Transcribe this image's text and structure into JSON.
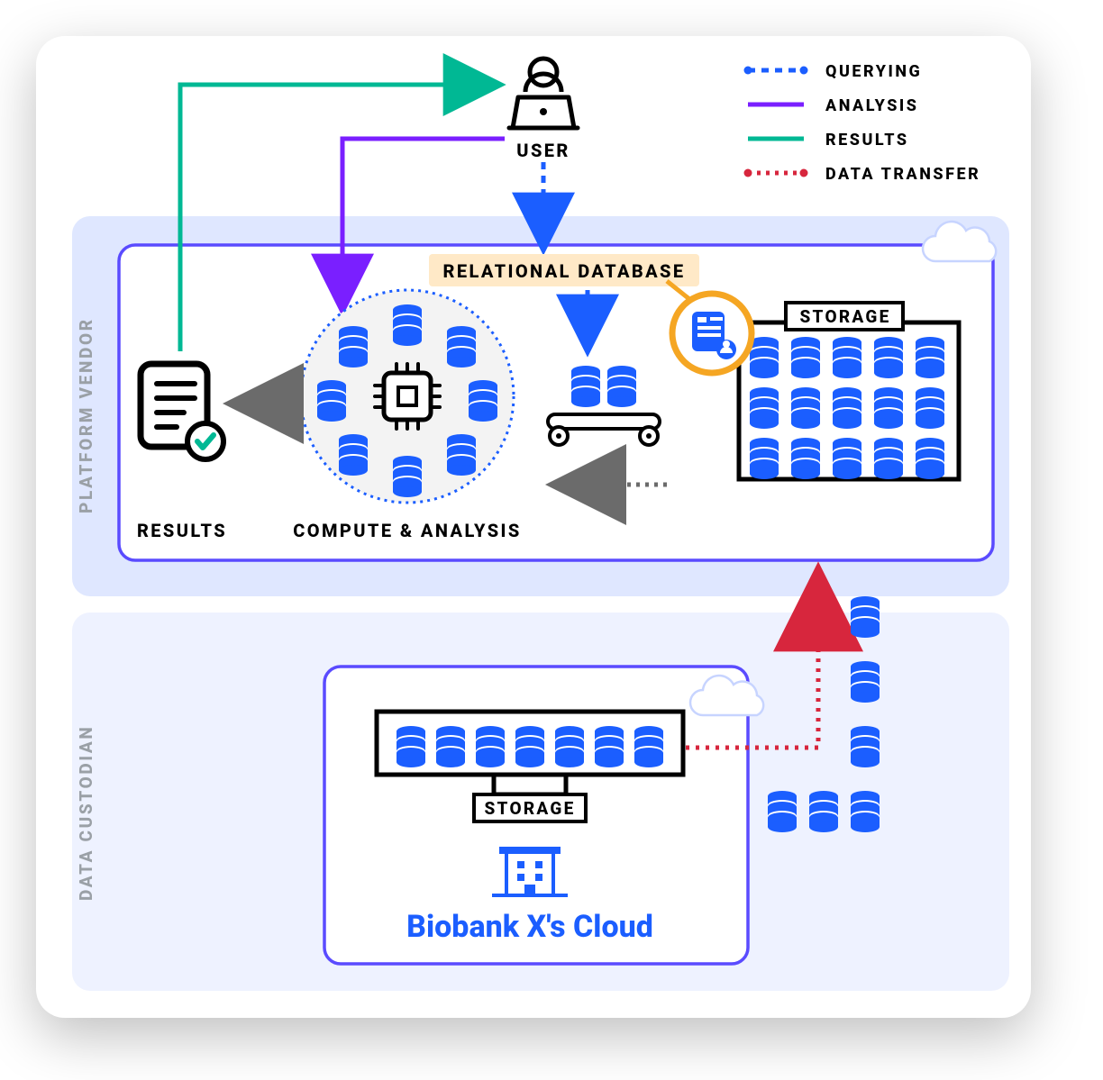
{
  "legend": {
    "querying": "QUERYING",
    "analysis": "ANALYSIS",
    "results": "RESULTS",
    "data_transfer": "DATA TRANSFER"
  },
  "labels": {
    "user": "USER",
    "relational_database": "RELATIONAL DATABASE",
    "results": "RESULTS",
    "compute_analysis": "COMPUTE & ANALYSIS",
    "storage_top": "STORAGE",
    "storage_bottom": "STORAGE",
    "biobank": "Biobank X's Cloud"
  },
  "regions": {
    "platform_vendor": "PLATFORM VENDOR",
    "data_custodian": "DATA CUSTODIAN"
  },
  "colors": {
    "querying": "#1b5eff",
    "analysis": "#7a1fff",
    "results": "#00b894",
    "data_transfer": "#d7263d",
    "db": "#1b5eff",
    "accentbg": "#dfe7ff",
    "lightbg": "#eef2ff",
    "highlight": "#ffe9c7",
    "gold": "#f5a623",
    "gray": "#6b6b6b"
  }
}
